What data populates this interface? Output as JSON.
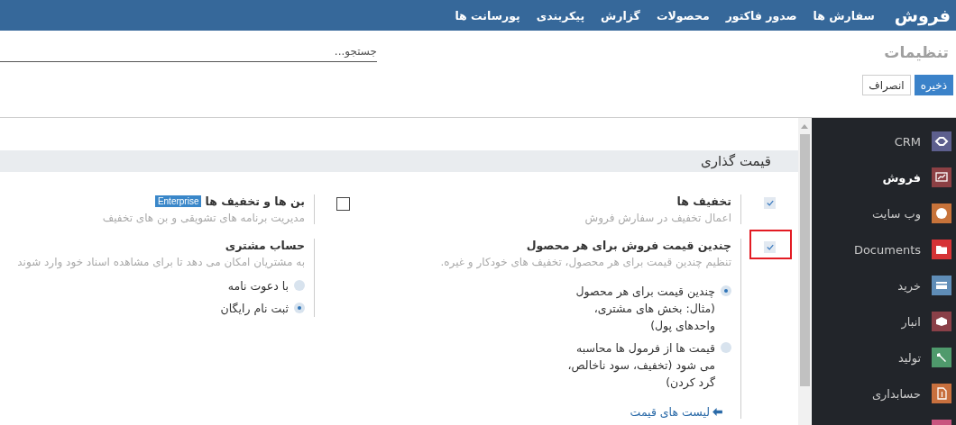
{
  "topbar": {
    "brand": "فروش",
    "menu": [
      "سفارش ها",
      "صدور فاکتور",
      "محصولات",
      "گزارش",
      "پیکربندی",
      "پورسانت ها"
    ]
  },
  "control_panel": {
    "title": "تنظیمات",
    "search": {
      "placeholder": "جستجو..."
    },
    "buttons": [
      {
        "label": "ذخیره",
        "kind": "primary"
      },
      {
        "label": "انصراف",
        "kind": "secondary"
      }
    ]
  },
  "section": {
    "title": "قیمت گذاری",
    "settings": [
      {
        "title": "تخفیف ها",
        "description": "اعمال تخفیف در سفارش فروش",
        "kind": "checkbox",
        "checked": true,
        "highlighted": false
      },
      {
        "title": "بن ها و تخفیف ها",
        "badge": "Enterprise",
        "description": "مدیریت برنامه های تشویقی و بن های تخفیف",
        "kind": "checkbox",
        "checked": false,
        "highlighted": false
      },
      {
        "title": "چندین قیمت فروش برای هر محصول",
        "description": "تنظیم چندین قیمت برای هر محصول، تخفیف های خودکار و غیره.",
        "kind": "checkbox",
        "checked": true,
        "highlighted": true,
        "options": [
          {
            "label": "چندین قیمت برای هر محصول (مثال: بخش های مشتری، واحدهای پول)",
            "selected": true
          },
          {
            "label": "قیمت ها از فرمول ها محاسبه می شود (تخفیف، سود ناخالص، گرد کردن)",
            "selected": false
          }
        ],
        "link": "لیست های قیمت"
      },
      {
        "title": "حساب مشتری",
        "description": "به مشتریان امکان می دهد تا برای مشاهده اسناد خود وارد شوند",
        "kind": "plain",
        "options": [
          {
            "label": "با دعوت نامه",
            "selected": false
          },
          {
            "label": "ثبت نام رایگان",
            "selected": true
          }
        ]
      }
    ]
  },
  "sidebar": {
    "items": [
      {
        "label": "CRM",
        "color": "#5d5f8e",
        "selected": false
      },
      {
        "label": "فروش",
        "color": "#8c4044",
        "selected": true
      },
      {
        "label": "وب سایت",
        "color": "#c7733a",
        "selected": false
      },
      {
        "label": "Documents",
        "color": "#d63336",
        "selected": false
      },
      {
        "label": "خرید",
        "color": "#5f8db7",
        "selected": false
      },
      {
        "label": "انبار",
        "color": "#8a4048",
        "selected": false
      },
      {
        "label": "تولید",
        "color": "#4f9a6c",
        "selected": false
      },
      {
        "label": "حسابداری",
        "color": "#c8703e",
        "selected": false
      },
      {
        "color": "#c9557f"
      }
    ]
  }
}
